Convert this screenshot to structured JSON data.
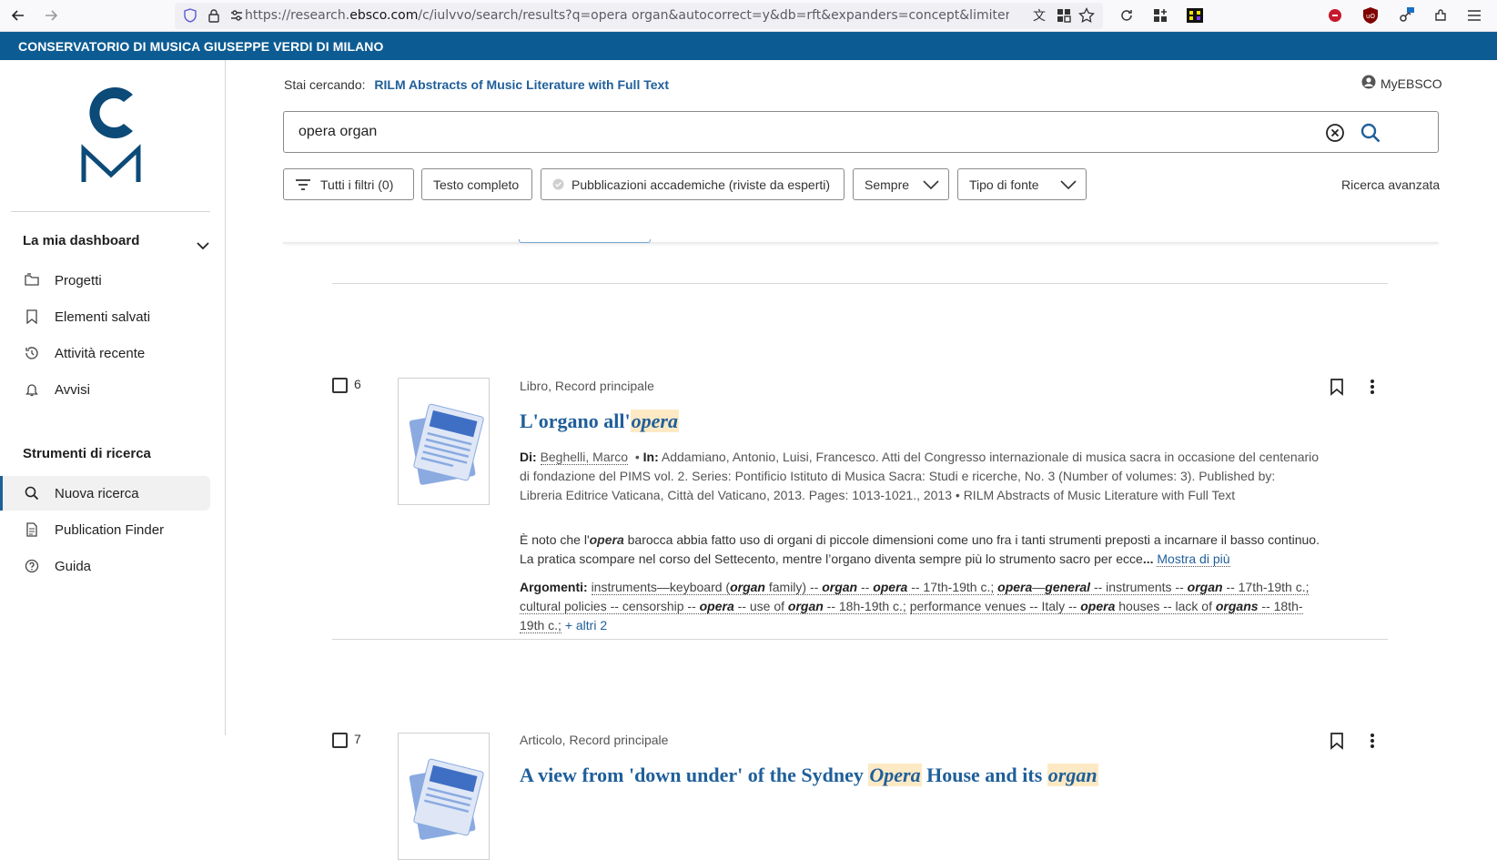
{
  "browser": {
    "url_prefix": "https://research.",
    "url_host": "ebsco.com",
    "url_rest": "/c/iulvvo/search/results?q=opera organ&autocorrect=y&db=rft&expanders=concept&limiters=None&"
  },
  "banner": {
    "institution": "CONSERVATORIO DI MUSICA GIUSEPPE VERDI DI MILANO"
  },
  "sidebar": {
    "dashboard_heading": "La mia dashboard",
    "dashboard_items": [
      {
        "label": "Progetti",
        "icon": "folders-icon"
      },
      {
        "label": "Elementi salvati",
        "icon": "bookmark-icon"
      },
      {
        "label": "Attività recente",
        "icon": "history-icon"
      },
      {
        "label": "Avvisi",
        "icon": "bell-icon"
      }
    ],
    "tools_heading": "Strumenti di ricerca",
    "tools_items": [
      {
        "label": "Nuova ricerca",
        "icon": "search-icon",
        "active": true
      },
      {
        "label": "Publication Finder",
        "icon": "document-icon"
      },
      {
        "label": "Guida",
        "icon": "help-icon"
      }
    ]
  },
  "header": {
    "searching_label": "Stai cercando:",
    "database": "RILM Abstracts of Music Literature with Full Text",
    "account": "MyEBSCO"
  },
  "search": {
    "query": "opera organ"
  },
  "filters": {
    "all_filters": "Tutti i filtri (0)",
    "full_text": "Testo completo",
    "peer_reviewed": "Pubblicazioni accademiche (riviste da esperti)",
    "date": "Sempre",
    "source_type": "Tipo di fonte",
    "advanced": "Ricerca avanzata"
  },
  "results": [
    {
      "number": "6",
      "type": "Libro, Record principale",
      "title_before": "L'organo all'",
      "title_highlight": "opera",
      "by_label": "Di:",
      "author": "Beghelli, Marco",
      "in_label": "In:",
      "source": "Addamiano, Antonio, Luisi, Francesco. Atti del Congresso internazionale di musica sacra in occasione del centenario di fondazione del PIMS vol. 2. Series: Pontificio Istituto di Musica Sacra: Studi e ricerche, No. 3 (Number of volumes: 3). Published by: Libreria Editrice Vaticana, Città del Vaticano, 2013. Pages: 1013-1021., 2013 • RILM Abstracts of Music Literature with Full Text",
      "abstract_1": "È noto che l'",
      "abstract_hl": "opera",
      "abstract_2": " barocca abbia fatto uso di organi di piccole dimensioni come uno fra i tanti strumenti preposti a incarnare il basso continuo. La pratica scompare nel corso del Settecento, mentre l’organo diventa sempre più lo strumento sacro per ecce",
      "abstract_ellipsis": "...",
      "show_more": "Mostra di più",
      "subjects_label": "Argomenti:",
      "more_subjects": "+ altri 2"
    },
    {
      "number": "7",
      "type": "Articolo, Record principale",
      "title_1": "A view from 'down under' of the Sydney ",
      "title_hl1": "Opera",
      "title_2": " House and its ",
      "title_hl2": "organ"
    }
  ]
}
